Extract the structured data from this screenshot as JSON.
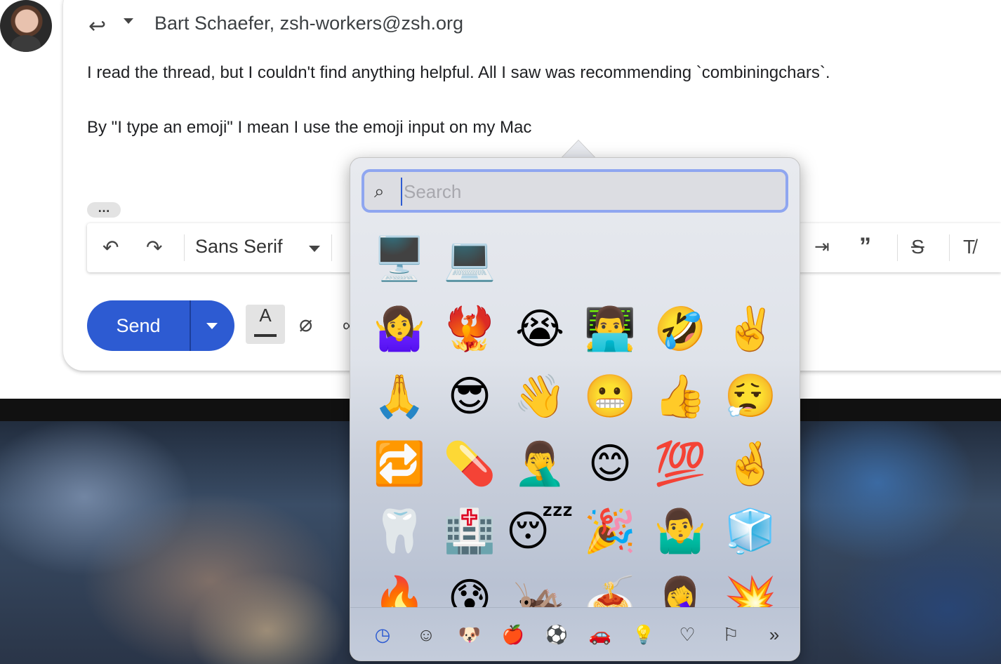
{
  "email": {
    "recipients": "Bart Schaefer, zsh-workers@zsh.org",
    "body_line1": "I read the thread, but I couldn't find anything helpful. All I saw was recommending `combiningchars`.",
    "body_line2": "By \"I type an emoji\" I mean I use the emoji input on my Mac"
  },
  "toolbar": {
    "font": "Sans Serif",
    "undo_icon": "undo-icon",
    "redo_icon": "redo-icon"
  },
  "actions": {
    "send_label": "Send",
    "format_label": "A"
  },
  "emoji_picker": {
    "search_placeholder": "Search",
    "rows": [
      [
        "🖥️",
        "💻"
      ],
      [
        "🤷‍♀️",
        "🐦‍🔥",
        "😭",
        "👨‍💻",
        "🤣",
        "✌️"
      ],
      [
        "🙏",
        "😎",
        "👋",
        "😬",
        "👍",
        "😮‍💨"
      ],
      [
        "🔁",
        "💊",
        "🤦‍♂️",
        "😊",
        "💯",
        "🤞"
      ],
      [
        "🦷",
        "🏥",
        "😴",
        "🎉",
        "🤷‍♂️",
        "🧊"
      ],
      [
        "🔥",
        "😰",
        "🦗",
        "🍝",
        "🤦‍♀️",
        "💥"
      ]
    ],
    "categories": [
      {
        "icon": "clock-icon",
        "glyph": "◷"
      },
      {
        "icon": "smiley-icon",
        "glyph": "☺"
      },
      {
        "icon": "animal-icon",
        "glyph": "🐶"
      },
      {
        "icon": "food-icon",
        "glyph": "🍎"
      },
      {
        "icon": "activity-icon",
        "glyph": "⚽"
      },
      {
        "icon": "travel-icon",
        "glyph": "🚗"
      },
      {
        "icon": "objects-icon",
        "glyph": "💡"
      },
      {
        "icon": "symbols-icon",
        "glyph": "♡"
      },
      {
        "icon": "flags-icon",
        "glyph": "⚐"
      },
      {
        "icon": "more-icon",
        "glyph": "»"
      }
    ]
  }
}
